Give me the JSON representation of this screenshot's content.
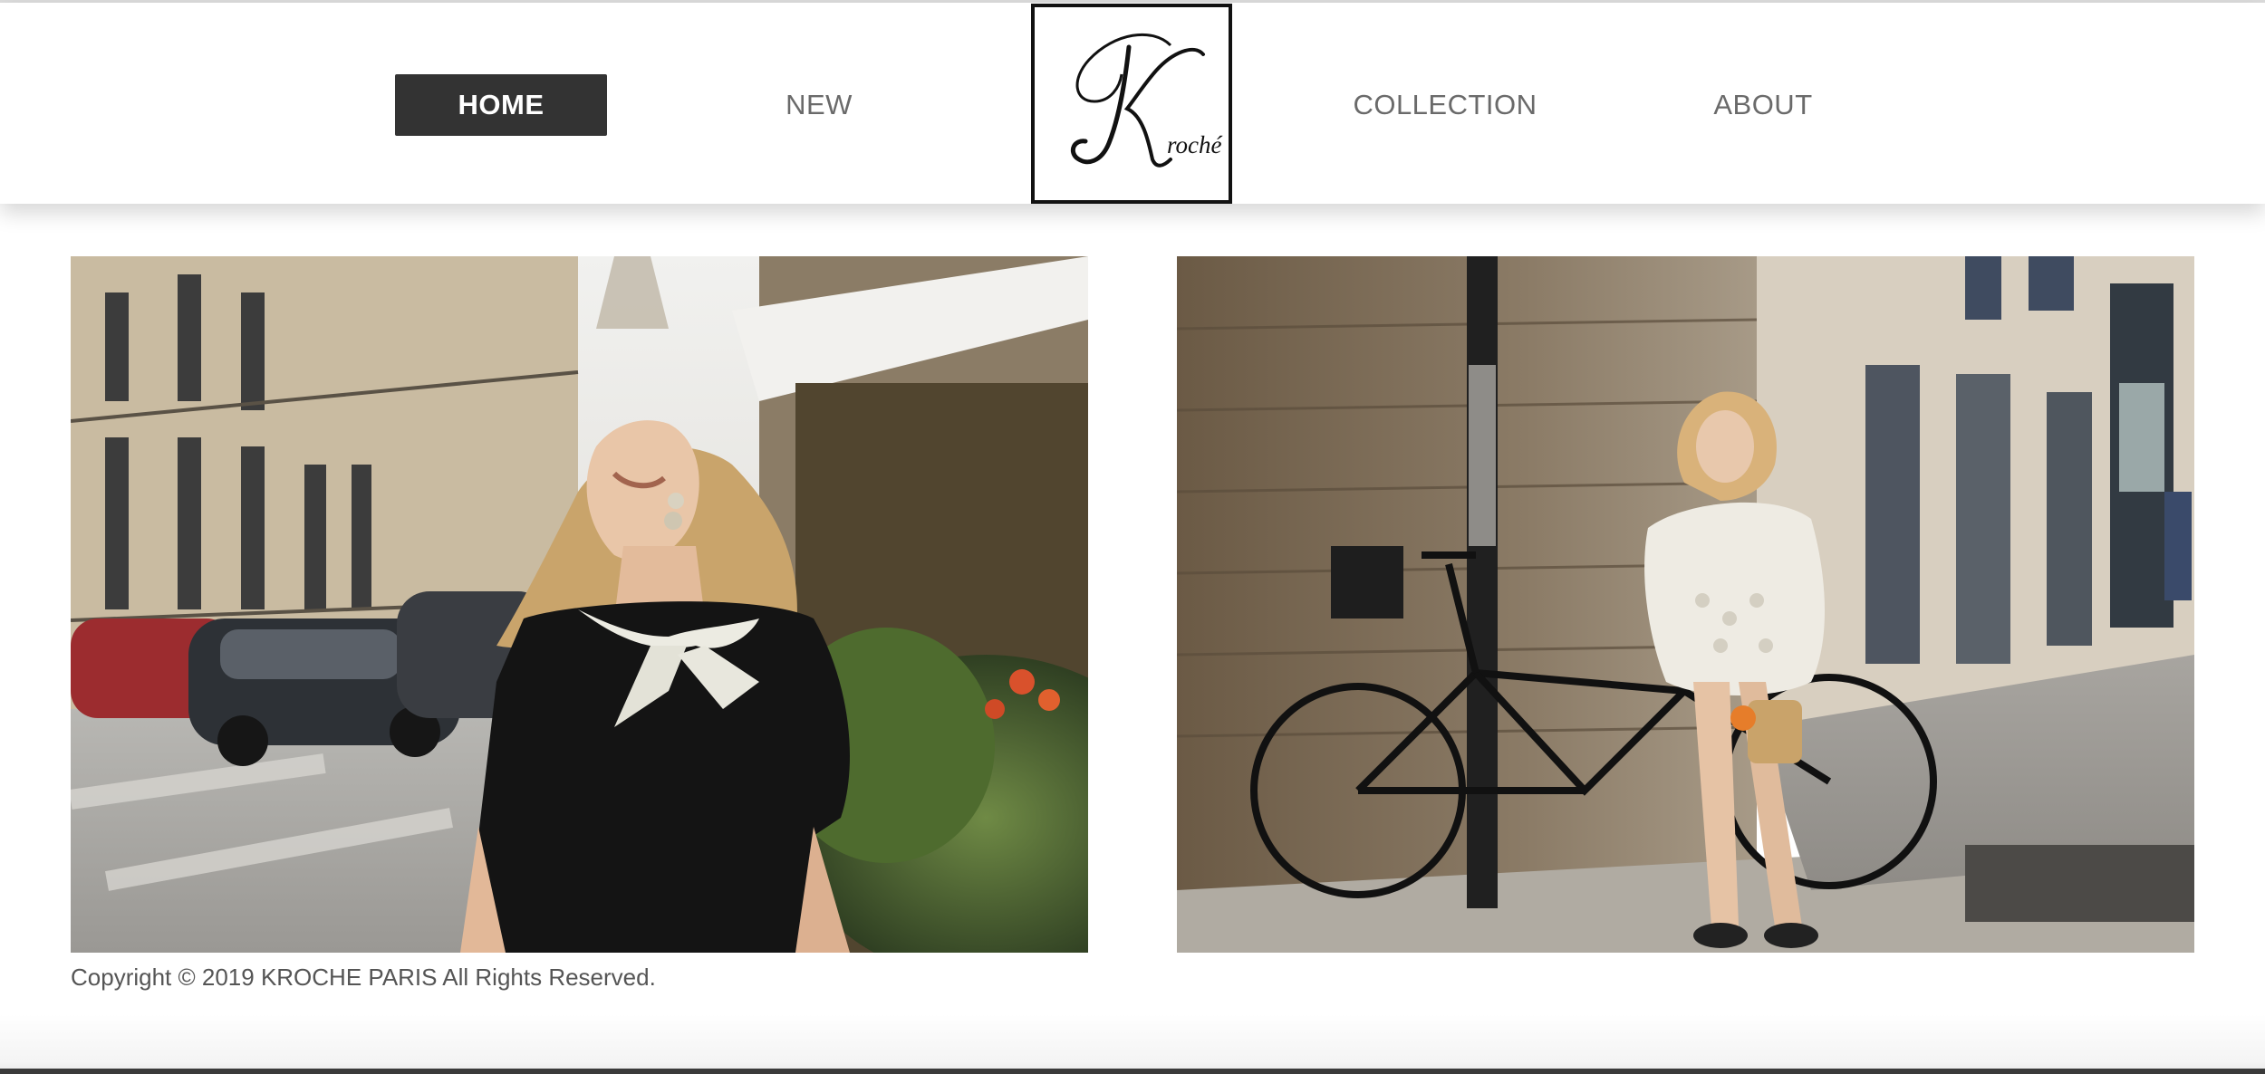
{
  "nav": {
    "items": [
      {
        "label": "HOME",
        "active": true
      },
      {
        "label": "NEW",
        "active": false
      },
      {
        "label": "COLLECTION",
        "active": false
      },
      {
        "label": "ABOUT",
        "active": false
      }
    ],
    "logo": {
      "letter": "K",
      "wordmark": "roché",
      "alt": "Kroché"
    }
  },
  "colors": {
    "active_nav_bg": "#333333",
    "nav_text": "#6a6a6a",
    "active_nav_text": "#ffffff"
  },
  "footer": {
    "copyright": "Copyright © 2019 KROCHE PARIS All Rights Reserved."
  }
}
